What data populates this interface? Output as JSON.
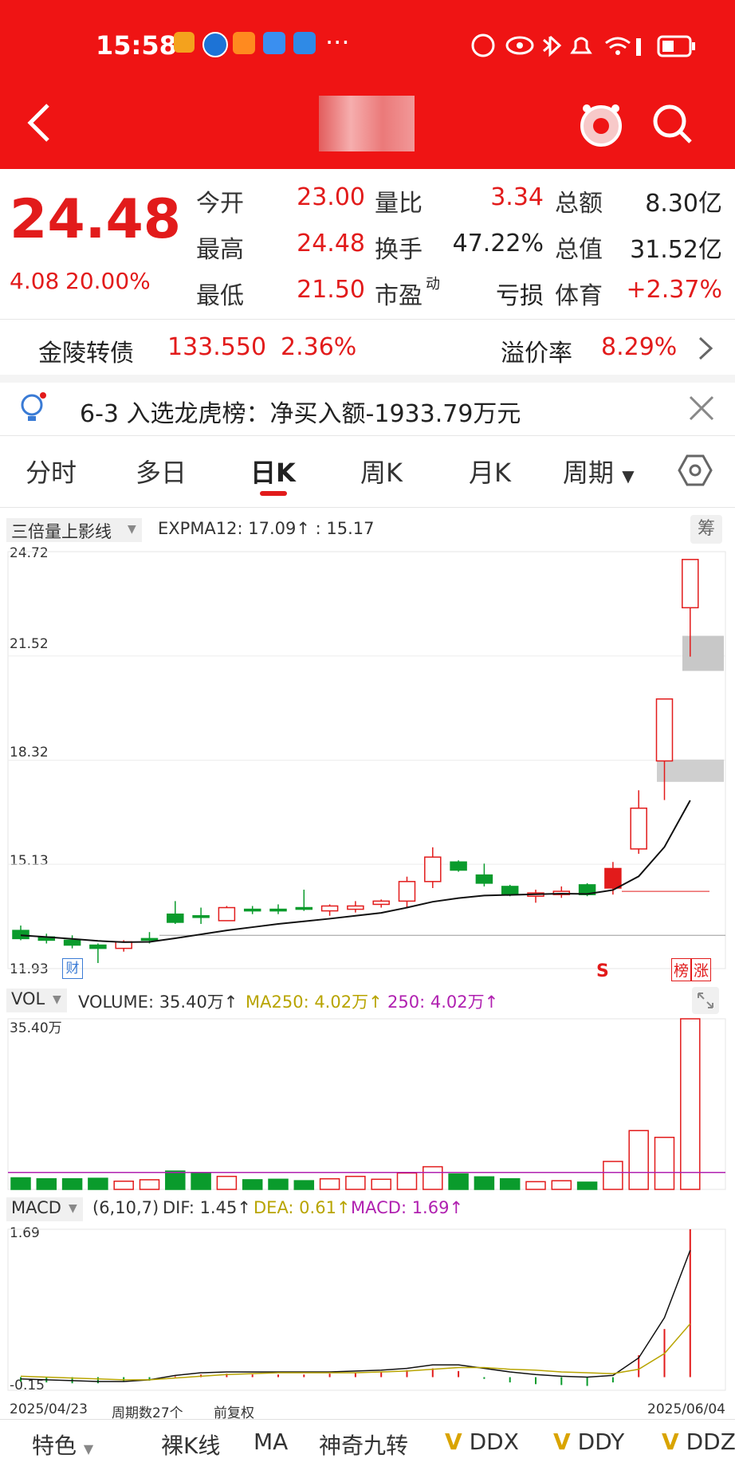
{
  "status_bar": {
    "time": "15:58",
    "more": "···"
  },
  "header": {
    "back_icon": "chevron-left-icon",
    "avatar_icon": "mascot-icon",
    "search_icon": "search-icon"
  },
  "quote": {
    "price": "24.48",
    "change": "4.08",
    "change_pct": "20.00%",
    "rows": [
      {
        "l1": "今开",
        "v1": "23.00",
        "l2": "量比",
        "v2": "3.34",
        "l3": "总额",
        "v3": "8.30亿"
      },
      {
        "l1": "最高",
        "v1": "24.48",
        "l2": "换手",
        "v2": "47.22%",
        "l3": "总值",
        "v3": "31.52亿"
      },
      {
        "l1": "最低",
        "v1": "21.50",
        "l2": "市盈",
        "l2_sup": "动",
        "v2": "亏损",
        "l3": "体育",
        "v3": "+2.37%"
      }
    ]
  },
  "bond": {
    "name": "金陵转债",
    "price": "133.550",
    "change": "2.36%",
    "premium_label": "溢价率",
    "premium": "8.29%"
  },
  "notice": {
    "text": "6-3 入选龙虎榜：净买入额-1933.79万元"
  },
  "tabs": [
    "分时",
    "多日",
    "日K",
    "周K",
    "月K",
    "周期"
  ],
  "active_tab": 2,
  "kline": {
    "indicator_select": "三倍量上影线",
    "expma": "EXPMA12: 17.09↑ : 15.17",
    "chip_btn": "筹",
    "y_labels": [
      "24.72",
      "21.52",
      "18.32",
      "15.13",
      "11.93"
    ],
    "cai_tag": "财",
    "s_tag": "S",
    "bang_tag": "榜",
    "zhang_tag": "涨"
  },
  "volume": {
    "select": "VOL",
    "label_main": "VOLUME: 35.40万↑",
    "label_ma": "MA250: 4.02万↑",
    "label_250": "250: 4.02万↑",
    "y_max": "35.40万"
  },
  "macd": {
    "select": "MACD",
    "params": "(6,10,7)",
    "dif": "DIF: 1.45↑",
    "dea": "DEA: 0.61↑",
    "macd": "MACD: 1.69↑",
    "y_max": "1.69",
    "y_min": "-0.15",
    "date_start": "2025/04/23",
    "period_count": "周期数27个",
    "adjust": "前复权",
    "date_end": "2025/06/04"
  },
  "bottom_bar": [
    "特色",
    "裸K线",
    "MA",
    "神奇九转",
    "DDX",
    "DDY",
    "DDZ"
  ],
  "colors": {
    "up": "#e21b1b",
    "down": "#0a9b2c",
    "header": "#ef1414",
    "ema": "#111111",
    "ma250": "#b8a400",
    "ma250b": "#b020b0"
  },
  "chart_data": [
    {
      "type": "candlestick",
      "title": "日K",
      "ylim": [
        11.93,
        24.72
      ],
      "candles": [
        {
          "open": 13.1,
          "close": 12.85,
          "high": 13.25,
          "low": 12.8
        },
        {
          "open": 12.9,
          "close": 12.8,
          "high": 13.0,
          "low": 12.7
        },
        {
          "open": 12.8,
          "close": 12.65,
          "high": 12.95,
          "low": 12.55
        },
        {
          "open": 12.65,
          "close": 12.55,
          "high": 12.7,
          "low": 12.1
        },
        {
          "open": 12.55,
          "close": 12.75,
          "high": 12.8,
          "low": 12.45
        },
        {
          "open": 12.85,
          "close": 12.8,
          "high": 13.05,
          "low": 12.7
        },
        {
          "open": 13.6,
          "close": 13.35,
          "high": 14.0,
          "low": 13.3
        },
        {
          "open": 13.55,
          "close": 13.5,
          "high": 13.8,
          "low": 13.3
        },
        {
          "open": 13.4,
          "close": 13.8,
          "high": 13.85,
          "low": 13.4
        },
        {
          "open": 13.75,
          "close": 13.7,
          "high": 13.85,
          "low": 13.6
        },
        {
          "open": 13.75,
          "close": 13.7,
          "high": 13.9,
          "low": 13.6
        },
        {
          "open": 13.8,
          "close": 13.75,
          "high": 14.35,
          "low": 13.7
        },
        {
          "open": 13.7,
          "close": 13.85,
          "high": 13.9,
          "low": 13.55
        },
        {
          "open": 13.75,
          "close": 13.85,
          "high": 14.0,
          "low": 13.65
        },
        {
          "open": 13.9,
          "close": 14.0,
          "high": 14.05,
          "low": 13.8
        },
        {
          "open": 14.0,
          "close": 14.6,
          "high": 14.75,
          "low": 13.8
        },
        {
          "open": 14.6,
          "close": 15.35,
          "high": 15.65,
          "low": 14.4
        },
        {
          "open": 15.2,
          "close": 14.95,
          "high": 15.25,
          "low": 14.9
        },
        {
          "open": 14.8,
          "close": 14.55,
          "high": 15.15,
          "low": 14.45
        },
        {
          "open": 14.45,
          "close": 14.2,
          "high": 14.5,
          "low": 14.15
        },
        {
          "open": 14.15,
          "close": 14.25,
          "high": 14.35,
          "low": 13.95
        },
        {
          "open": 14.2,
          "close": 14.3,
          "high": 14.45,
          "low": 14.1
        },
        {
          "open": 14.5,
          "close": 14.2,
          "high": 14.55,
          "low": 14.15
        },
        {
          "open": 14.4,
          "close": 15.0,
          "high": 15.2,
          "low": 14.2
        },
        {
          "open": 15.6,
          "close": 16.85,
          "high": 17.4,
          "low": 15.45
        },
        {
          "open": 18.3,
          "close": 20.2,
          "high": 20.2,
          "low": 17.1
        },
        {
          "open": 23.0,
          "close": 24.48,
          "high": 24.48,
          "low": 21.5
        }
      ],
      "ema_line": [
        12.95,
        12.9,
        12.84,
        12.78,
        12.74,
        12.75,
        12.86,
        12.98,
        13.1,
        13.2,
        13.3,
        13.38,
        13.46,
        13.55,
        13.64,
        13.8,
        13.98,
        14.09,
        14.17,
        14.19,
        14.21,
        14.23,
        14.22,
        14.34,
        14.76,
        15.66,
        17.09
      ]
    },
    {
      "type": "bar",
      "title": "VOLUME",
      "ylim": [
        0,
        35.4
      ],
      "values": [
        2.4,
        2.2,
        2.2,
        2.3,
        1.7,
        2.0,
        3.8,
        3.5,
        2.7,
        2.0,
        2.1,
        1.8,
        2.2,
        2.7,
        2.1,
        3.4,
        4.7,
        3.2,
        2.6,
        2.2,
        1.6,
        1.8,
        1.5,
        5.8,
        12.2,
        10.8,
        35.4
      ],
      "direction": [
        "down",
        "down",
        "down",
        "down",
        "up",
        "up",
        "down",
        "down",
        "up",
        "down",
        "down",
        "down",
        "up",
        "up",
        "up",
        "up",
        "up",
        "down",
        "down",
        "down",
        "up",
        "up",
        "down",
        "up",
        "up",
        "up",
        "up"
      ],
      "ma250": 4.02
    },
    {
      "type": "bar",
      "title": "MACD",
      "ylim": [
        -0.15,
        1.69
      ],
      "hist": [
        -0.05,
        -0.06,
        -0.07,
        -0.07,
        -0.05,
        -0.04,
        0.01,
        0.03,
        0.04,
        0.03,
        0.03,
        0.03,
        0.04,
        0.05,
        0.06,
        0.08,
        0.1,
        0.07,
        -0.02,
        -0.06,
        -0.08,
        -0.09,
        -0.1,
        -0.06,
        0.25,
        0.55,
        1.69
      ],
      "dif": [
        -0.02,
        -0.03,
        -0.04,
        -0.05,
        -0.05,
        -0.03,
        0.02,
        0.05,
        0.06,
        0.06,
        0.06,
        0.06,
        0.06,
        0.07,
        0.08,
        0.1,
        0.14,
        0.14,
        0.1,
        0.06,
        0.03,
        0.01,
        0.0,
        0.02,
        0.22,
        0.68,
        1.45
      ],
      "dea": [
        0.01,
        0.0,
        -0.01,
        -0.02,
        -0.03,
        -0.03,
        -0.01,
        0.01,
        0.03,
        0.04,
        0.05,
        0.05,
        0.05,
        0.05,
        0.06,
        0.07,
        0.09,
        0.11,
        0.11,
        0.09,
        0.08,
        0.06,
        0.05,
        0.04,
        0.09,
        0.27,
        0.61
      ]
    }
  ]
}
